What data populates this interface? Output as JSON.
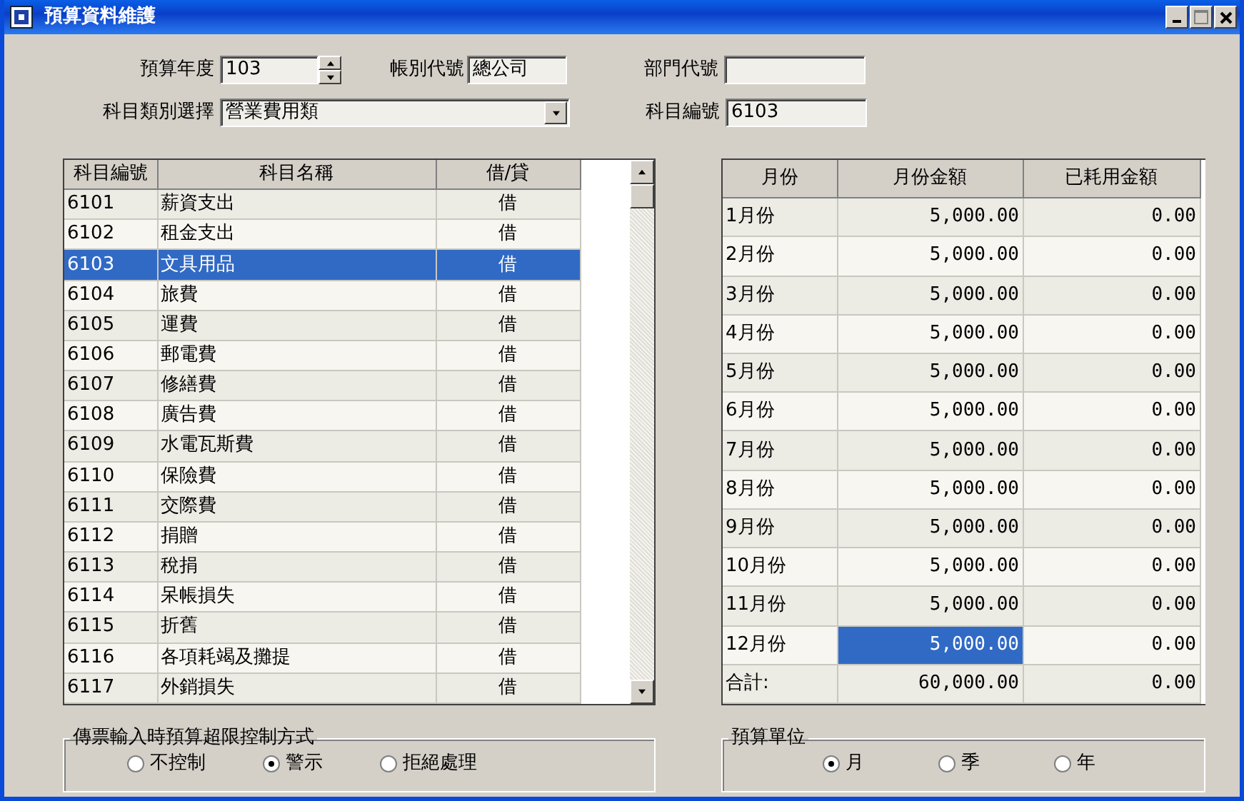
{
  "window": {
    "title": "預算資料維護"
  },
  "form": {
    "year_label": "預算年度",
    "year_value": "103",
    "account_label": "帳別代號",
    "account_value": "總公司",
    "dept_label": "部門代號",
    "category_label": "科目類別選擇",
    "category_value": "營業費用類",
    "code_label": "科目編號",
    "code_value": "6103"
  },
  "subjects": {
    "columns": [
      "科目編號",
      "科目名稱",
      "借/貸"
    ],
    "rows": [
      {
        "code": "6101",
        "name": "薪資支出",
        "side": "借",
        "selected": false
      },
      {
        "code": "6102",
        "name": "租金支出",
        "side": "借",
        "selected": false
      },
      {
        "code": "6103",
        "name": "文具用品",
        "side": "借",
        "selected": true
      },
      {
        "code": "6104",
        "name": "旅費",
        "side": "借",
        "selected": false
      },
      {
        "code": "6105",
        "name": "運費",
        "side": "借",
        "selected": false
      },
      {
        "code": "6106",
        "name": "郵電費",
        "side": "借",
        "selected": false
      },
      {
        "code": "6107",
        "name": "修繕費",
        "side": "借",
        "selected": false
      },
      {
        "code": "6108",
        "name": "廣告費",
        "side": "借",
        "selected": false
      },
      {
        "code": "6109",
        "name": "水電瓦斯費",
        "side": "借",
        "selected": false
      },
      {
        "code": "6110",
        "name": "保險費",
        "side": "借",
        "selected": false
      },
      {
        "code": "6111",
        "name": "交際費",
        "side": "借",
        "selected": false
      },
      {
        "code": "6112",
        "name": "捐贈",
        "side": "借",
        "selected": false
      },
      {
        "code": "6113",
        "name": "稅捐",
        "side": "借",
        "selected": false
      },
      {
        "code": "6114",
        "name": "呆帳損失",
        "side": "借",
        "selected": false
      },
      {
        "code": "6115",
        "name": "折舊",
        "side": "借",
        "selected": false
      },
      {
        "code": "6116",
        "name": "各項耗竭及攤提",
        "side": "借",
        "selected": false
      },
      {
        "code": "6117",
        "name": "外銷損失",
        "side": "借",
        "selected": false
      }
    ]
  },
  "months": {
    "columns": [
      "月份",
      "月份金額",
      "已耗用金額"
    ],
    "rows": [
      {
        "month": "1月份",
        "amount": "5,000.00",
        "used": "0.00",
        "selected": false
      },
      {
        "month": "2月份",
        "amount": "5,000.00",
        "used": "0.00",
        "selected": false
      },
      {
        "month": "3月份",
        "amount": "5,000.00",
        "used": "0.00",
        "selected": false
      },
      {
        "month": "4月份",
        "amount": "5,000.00",
        "used": "0.00",
        "selected": false
      },
      {
        "month": "5月份",
        "amount": "5,000.00",
        "used": "0.00",
        "selected": false
      },
      {
        "month": "6月份",
        "amount": "5,000.00",
        "used": "0.00",
        "selected": false
      },
      {
        "month": "7月份",
        "amount": "5,000.00",
        "used": "0.00",
        "selected": false
      },
      {
        "month": "8月份",
        "amount": "5,000.00",
        "used": "0.00",
        "selected": false
      },
      {
        "month": "9月份",
        "amount": "5,000.00",
        "used": "0.00",
        "selected": false
      },
      {
        "month": "10月份",
        "amount": "5,000.00",
        "used": "0.00",
        "selected": false
      },
      {
        "month": "11月份",
        "amount": "5,000.00",
        "used": "0.00",
        "selected": false
      },
      {
        "month": "12月份",
        "amount": "5,000.00",
        "used": "0.00",
        "selected": true
      },
      {
        "month": "合計:",
        "amount": "60,000.00",
        "used": "0.00",
        "selected": false
      }
    ]
  },
  "control_mode": {
    "title": "傳票輸入時預算超限控制方式",
    "options": [
      {
        "label": "不控制",
        "selected": false
      },
      {
        "label": "警示",
        "selected": true
      },
      {
        "label": "拒絕處理",
        "selected": false
      }
    ]
  },
  "budget_unit": {
    "title": "預算單位",
    "options": [
      {
        "label": "月",
        "selected": true
      },
      {
        "label": "季",
        "selected": false
      },
      {
        "label": "年",
        "selected": false
      }
    ]
  }
}
